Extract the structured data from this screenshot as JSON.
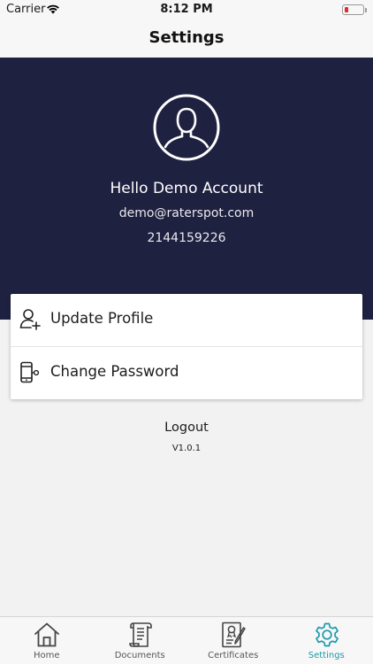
{
  "status_bar": {
    "carrier": "Carrier",
    "time": "8:12 PM"
  },
  "nav": {
    "title": "Settings"
  },
  "profile": {
    "greeting": "Hello Demo Account",
    "email": "demo@raterspot.com",
    "phone": "2144159226"
  },
  "menu": {
    "items": [
      {
        "label": "Update Profile",
        "icon": "user-add-icon"
      },
      {
        "label": "Change Password",
        "icon": "phone-lock-icon"
      }
    ]
  },
  "logout_label": "Logout",
  "version": "V1.0.1",
  "tabs": [
    {
      "label": "Home",
      "icon": "home-icon",
      "active": false
    },
    {
      "label": "Documents",
      "icon": "documents-icon",
      "active": false
    },
    {
      "label": "Certificates",
      "icon": "certificate-icon",
      "active": false
    },
    {
      "label": "Settings",
      "icon": "gear-icon",
      "active": true
    }
  ],
  "colors": {
    "header_bg": "#1f2140",
    "accent": "#1d9aaa",
    "battery_low": "#e32b2b"
  }
}
